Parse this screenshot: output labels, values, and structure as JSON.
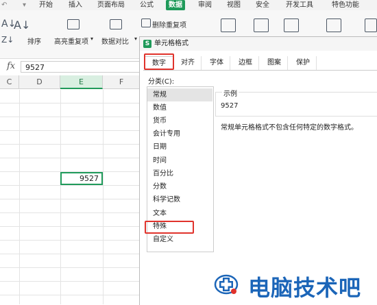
{
  "ribbon": {
    "menu": [
      "开始",
      "插入",
      "页面布局",
      "公式",
      "数据",
      "审阅",
      "视图",
      "安全",
      "开发工具",
      "特色功能"
    ],
    "active_menu": "数据",
    "sort_label": "排序",
    "highlight_dup_label": "高亮重复项",
    "compare_label": "数据对比",
    "delete_dup_label": "删除重复项"
  },
  "formula_bar": {
    "fx": "fx",
    "value": "9527"
  },
  "sheet": {
    "columns": [
      "C",
      "D",
      "E",
      "F"
    ],
    "selected_column": "E",
    "active_cell_value": "9527"
  },
  "dialog": {
    "title": "单元格格式",
    "logo": "S",
    "tabs": [
      "数字",
      "对齐",
      "字体",
      "边框",
      "图案",
      "保护"
    ],
    "active_tab": "数字",
    "category_label": "分类(C):",
    "categories": [
      "常规",
      "数值",
      "货币",
      "会计专用",
      "日期",
      "时间",
      "百分比",
      "分数",
      "科学记数",
      "文本",
      "特殊",
      "自定义"
    ],
    "selected_category": "常规",
    "sample_label": "示例",
    "sample_value": "9527",
    "description": "常规单元格格式不包含任何特定的数字格式。"
  },
  "watermark": {
    "text": "电脑技术吧"
  },
  "colors": {
    "accent": "#1f9a5a",
    "highlight": "#e0322b",
    "watermark": "#1b65b8"
  }
}
